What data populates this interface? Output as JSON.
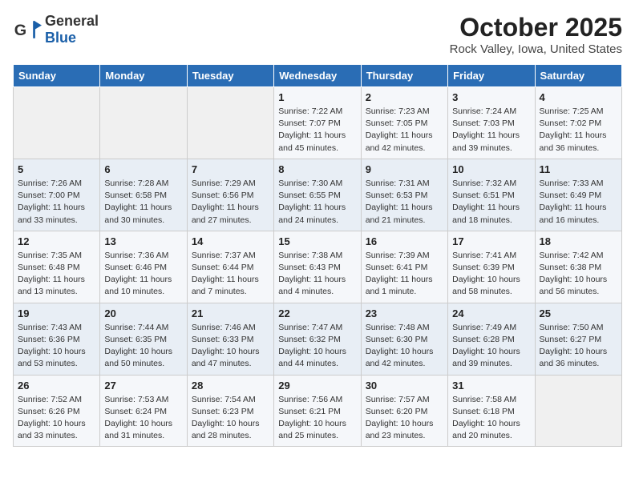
{
  "header": {
    "logo_general": "General",
    "logo_blue": "Blue",
    "month_title": "October 2025",
    "location": "Rock Valley, Iowa, United States"
  },
  "weekdays": [
    "Sunday",
    "Monday",
    "Tuesday",
    "Wednesday",
    "Thursday",
    "Friday",
    "Saturday"
  ],
  "weeks": [
    [
      {
        "day": "",
        "info": ""
      },
      {
        "day": "",
        "info": ""
      },
      {
        "day": "",
        "info": ""
      },
      {
        "day": "1",
        "info": "Sunrise: 7:22 AM\nSunset: 7:07 PM\nDaylight: 11 hours and 45 minutes."
      },
      {
        "day": "2",
        "info": "Sunrise: 7:23 AM\nSunset: 7:05 PM\nDaylight: 11 hours and 42 minutes."
      },
      {
        "day": "3",
        "info": "Sunrise: 7:24 AM\nSunset: 7:03 PM\nDaylight: 11 hours and 39 minutes."
      },
      {
        "day": "4",
        "info": "Sunrise: 7:25 AM\nSunset: 7:02 PM\nDaylight: 11 hours and 36 minutes."
      }
    ],
    [
      {
        "day": "5",
        "info": "Sunrise: 7:26 AM\nSunset: 7:00 PM\nDaylight: 11 hours and 33 minutes."
      },
      {
        "day": "6",
        "info": "Sunrise: 7:28 AM\nSunset: 6:58 PM\nDaylight: 11 hours and 30 minutes."
      },
      {
        "day": "7",
        "info": "Sunrise: 7:29 AM\nSunset: 6:56 PM\nDaylight: 11 hours and 27 minutes."
      },
      {
        "day": "8",
        "info": "Sunrise: 7:30 AM\nSunset: 6:55 PM\nDaylight: 11 hours and 24 minutes."
      },
      {
        "day": "9",
        "info": "Sunrise: 7:31 AM\nSunset: 6:53 PM\nDaylight: 11 hours and 21 minutes."
      },
      {
        "day": "10",
        "info": "Sunrise: 7:32 AM\nSunset: 6:51 PM\nDaylight: 11 hours and 18 minutes."
      },
      {
        "day": "11",
        "info": "Sunrise: 7:33 AM\nSunset: 6:49 PM\nDaylight: 11 hours and 16 minutes."
      }
    ],
    [
      {
        "day": "12",
        "info": "Sunrise: 7:35 AM\nSunset: 6:48 PM\nDaylight: 11 hours and 13 minutes."
      },
      {
        "day": "13",
        "info": "Sunrise: 7:36 AM\nSunset: 6:46 PM\nDaylight: 11 hours and 10 minutes."
      },
      {
        "day": "14",
        "info": "Sunrise: 7:37 AM\nSunset: 6:44 PM\nDaylight: 11 hours and 7 minutes."
      },
      {
        "day": "15",
        "info": "Sunrise: 7:38 AM\nSunset: 6:43 PM\nDaylight: 11 hours and 4 minutes."
      },
      {
        "day": "16",
        "info": "Sunrise: 7:39 AM\nSunset: 6:41 PM\nDaylight: 11 hours and 1 minute."
      },
      {
        "day": "17",
        "info": "Sunrise: 7:41 AM\nSunset: 6:39 PM\nDaylight: 10 hours and 58 minutes."
      },
      {
        "day": "18",
        "info": "Sunrise: 7:42 AM\nSunset: 6:38 PM\nDaylight: 10 hours and 56 minutes."
      }
    ],
    [
      {
        "day": "19",
        "info": "Sunrise: 7:43 AM\nSunset: 6:36 PM\nDaylight: 10 hours and 53 minutes."
      },
      {
        "day": "20",
        "info": "Sunrise: 7:44 AM\nSunset: 6:35 PM\nDaylight: 10 hours and 50 minutes."
      },
      {
        "day": "21",
        "info": "Sunrise: 7:46 AM\nSunset: 6:33 PM\nDaylight: 10 hours and 47 minutes."
      },
      {
        "day": "22",
        "info": "Sunrise: 7:47 AM\nSunset: 6:32 PM\nDaylight: 10 hours and 44 minutes."
      },
      {
        "day": "23",
        "info": "Sunrise: 7:48 AM\nSunset: 6:30 PM\nDaylight: 10 hours and 42 minutes."
      },
      {
        "day": "24",
        "info": "Sunrise: 7:49 AM\nSunset: 6:28 PM\nDaylight: 10 hours and 39 minutes."
      },
      {
        "day": "25",
        "info": "Sunrise: 7:50 AM\nSunset: 6:27 PM\nDaylight: 10 hours and 36 minutes."
      }
    ],
    [
      {
        "day": "26",
        "info": "Sunrise: 7:52 AM\nSunset: 6:26 PM\nDaylight: 10 hours and 33 minutes."
      },
      {
        "day": "27",
        "info": "Sunrise: 7:53 AM\nSunset: 6:24 PM\nDaylight: 10 hours and 31 minutes."
      },
      {
        "day": "28",
        "info": "Sunrise: 7:54 AM\nSunset: 6:23 PM\nDaylight: 10 hours and 28 minutes."
      },
      {
        "day": "29",
        "info": "Sunrise: 7:56 AM\nSunset: 6:21 PM\nDaylight: 10 hours and 25 minutes."
      },
      {
        "day": "30",
        "info": "Sunrise: 7:57 AM\nSunset: 6:20 PM\nDaylight: 10 hours and 23 minutes."
      },
      {
        "day": "31",
        "info": "Sunrise: 7:58 AM\nSunset: 6:18 PM\nDaylight: 10 hours and 20 minutes."
      },
      {
        "day": "",
        "info": ""
      }
    ]
  ]
}
